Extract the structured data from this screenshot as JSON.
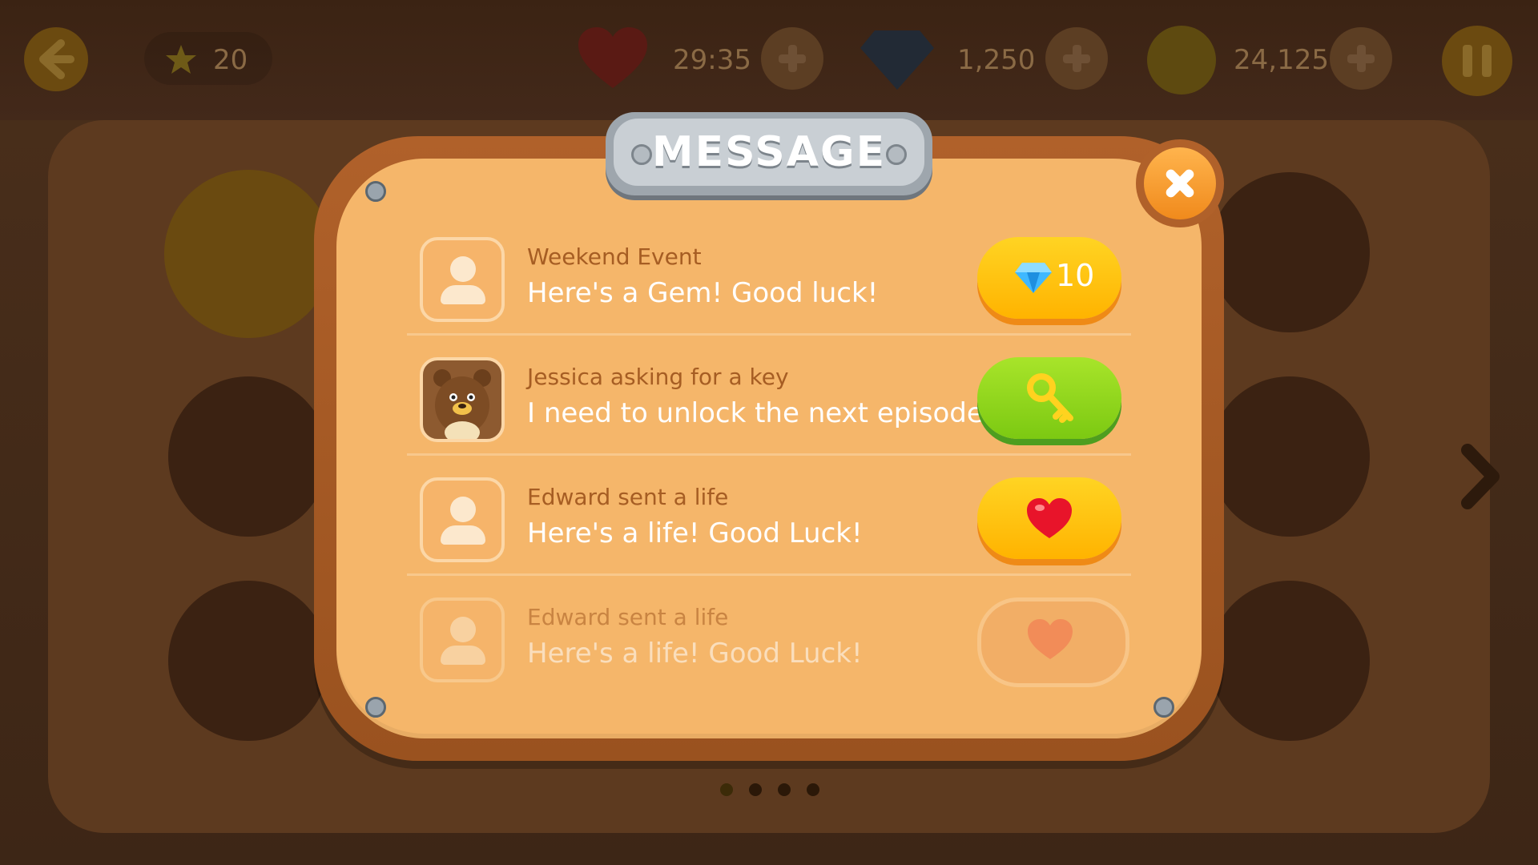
{
  "hud": {
    "stars": "20",
    "lives_timer": "29:35",
    "gems": "1,250",
    "coins": "24,125"
  },
  "dialog": {
    "title": "MESSAGE",
    "messages": [
      {
        "sender": "Weekend Event",
        "text": "Here's a Gem! Good luck!",
        "avatar": "person-icon",
        "action_icon": "gem-icon",
        "action_label": "10",
        "state": "active"
      },
      {
        "sender": "Jessica asking for a key",
        "text": "I need to unlock the next episode!",
        "avatar": "bear-avatar",
        "action_icon": "key-icon",
        "action_label": "",
        "state": "active"
      },
      {
        "sender": "Edward sent a life",
        "text": "Here's a life! Good Luck!",
        "avatar": "person-icon",
        "action_icon": "heart-icon",
        "action_label": "",
        "state": "active"
      },
      {
        "sender": "Edward sent a life",
        "text": "Here's a life! Good Luck!",
        "avatar": "person-icon",
        "action_icon": "heart-icon",
        "action_label": "",
        "state": "claimed"
      }
    ]
  },
  "pagination": {
    "pages": 4,
    "current": 1
  },
  "colors": {
    "panel": "#f5b66a",
    "frame": "#a85a24",
    "sender_text": "#a65d23",
    "button_yellow": "#ffc107",
    "button_green": "#8bd11a"
  }
}
